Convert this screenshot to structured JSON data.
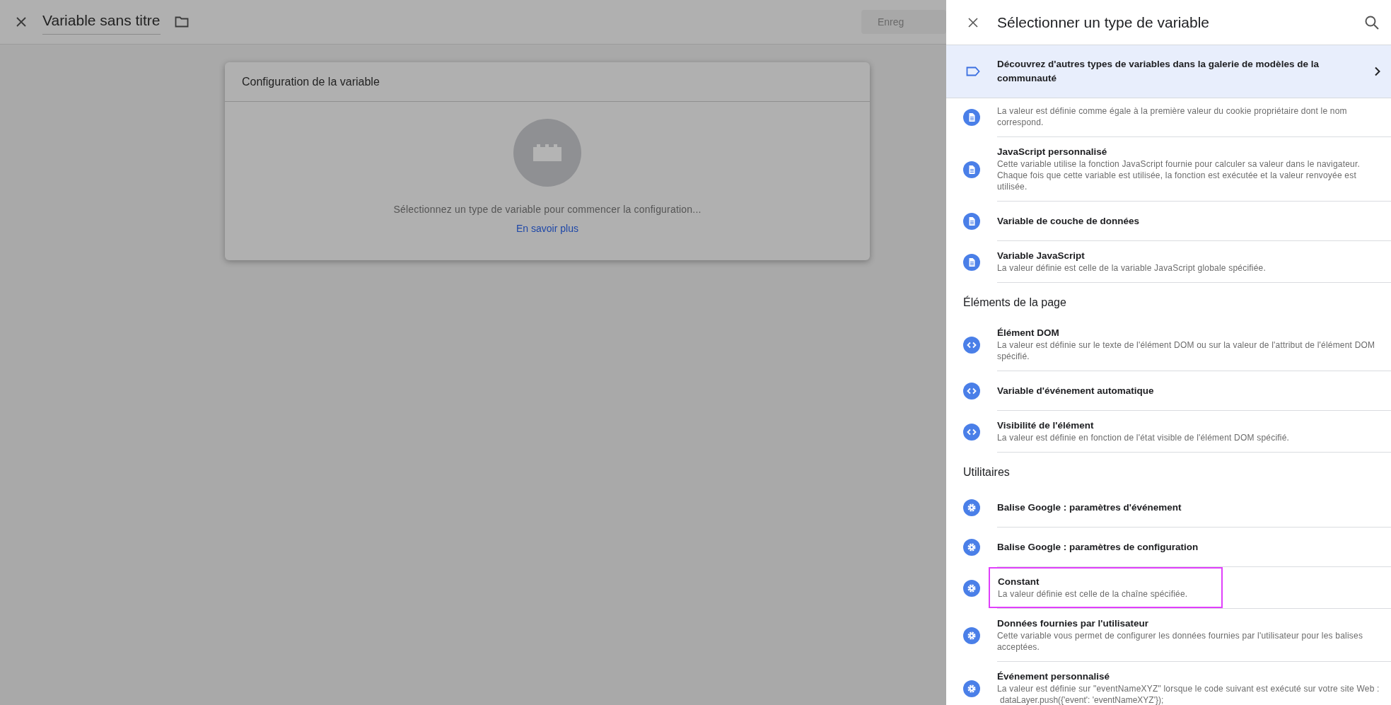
{
  "editor": {
    "title": "Variable sans titre",
    "save_button": "Enreg"
  },
  "config_card": {
    "title": "Configuration de la variable",
    "prompt": "Sélectionnez un type de variable pour commencer la configuration...",
    "link": "En savoir plus"
  },
  "panel": {
    "title": "Sélectionner un type de variable",
    "banner": "Découvrez d'autres types de variables dans la galerie de modèles de la communauté",
    "sections": [
      {
        "items": [
          {
            "kind": "document",
            "description": "La valeur est définie comme égale à la première valeur du cookie propriétaire dont le nom correspond.",
            "highlighted": false
          },
          {
            "kind": "document",
            "title": "JavaScript personnalisé",
            "description": "Cette variable utilise la fonction JavaScript fournie pour calculer sa valeur dans le navigateur. Chaque fois que cette variable est utilisée, la fonction est exécutée et la valeur renvoyée est utilisée.",
            "highlighted": false
          },
          {
            "kind": "document",
            "title": "Variable de couche de données",
            "highlighted": false
          },
          {
            "kind": "document",
            "title": "Variable JavaScript",
            "description": "La valeur définie est celle de la variable JavaScript globale spécifiée.",
            "highlighted": false
          }
        ]
      },
      {
        "heading": "Éléments de la page",
        "items": [
          {
            "kind": "code",
            "title": "Élément DOM",
            "description": "La valeur est définie sur le texte de l'élément DOM ou sur la valeur de l'attribut de l'élément DOM spécifié.",
            "highlighted": false
          },
          {
            "kind": "code",
            "title": "Variable d'événement automatique",
            "highlighted": false
          },
          {
            "kind": "code",
            "title": "Visibilité de l'élément",
            "description": "La valeur est définie en fonction de l'état visible de l'élément DOM spécifié.",
            "highlighted": false
          }
        ]
      },
      {
        "heading": "Utilitaires",
        "items": [
          {
            "kind": "gear",
            "title": "Balise Google : paramètres d'événement",
            "highlighted": false
          },
          {
            "kind": "gear",
            "title": "Balise Google : paramètres de configuration",
            "highlighted": false
          },
          {
            "kind": "gear",
            "title": "Constant",
            "description": "La valeur définie est celle de la chaîne spécifiée.",
            "highlighted": true
          },
          {
            "kind": "gear",
            "title": "Données fournies par l'utilisateur",
            "description": "Cette variable vous permet de configurer les données fournies par l'utilisateur pour les balises acceptées.",
            "highlighted": false
          },
          {
            "kind": "gear",
            "title": "Événement personnalisé",
            "description": "La valeur est définie sur \"eventNameXYZ\" lorsque le code suivant est exécuté sur votre site Web :",
            "code": "dataLayer.push({'event': 'eventNameXYZ'});",
            "highlighted": false
          }
        ]
      }
    ]
  }
}
